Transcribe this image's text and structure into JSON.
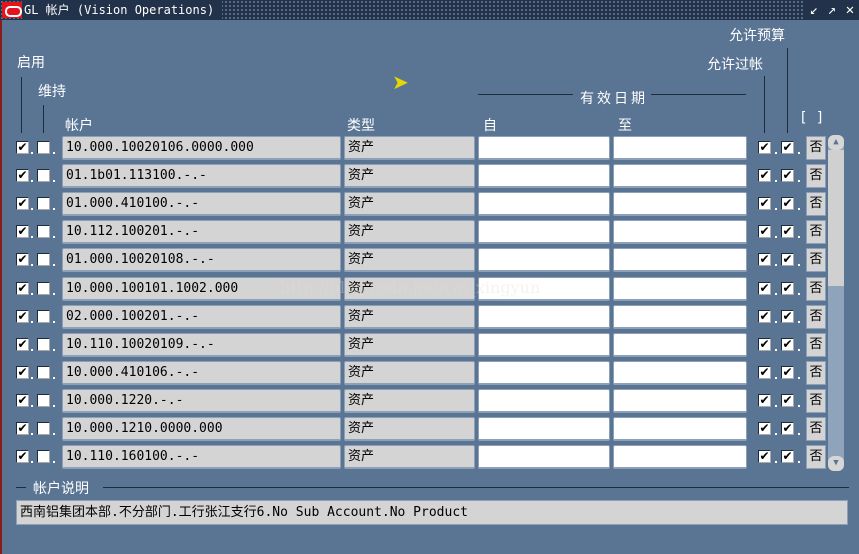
{
  "window": {
    "title": "GL 帐户 (Vision Operations)",
    "buttons": [
      "minimize",
      "restore",
      "close"
    ]
  },
  "headers": {
    "enabled": "启用",
    "maintain": "维持",
    "account": "帐户",
    "type": "类型",
    "effective_dates": "有效日期",
    "from": "自",
    "to": "至",
    "allow_posting": "允许过帐",
    "allow_budget": "允许预算",
    "brackets": "[ ]"
  },
  "rows": [
    {
      "account": "10.000.10020106.0000.000",
      "type": "资产",
      "enabled": true,
      "maintain": false,
      "from": "",
      "to": "",
      "posting": true,
      "budget": true,
      "flag": "否"
    },
    {
      "account": "01.1b01.113100.-.-",
      "type": "资产",
      "enabled": true,
      "maintain": false,
      "from": "",
      "to": "",
      "posting": true,
      "budget": true,
      "flag": "否"
    },
    {
      "account": "01.000.410100.-.-",
      "type": "资产",
      "enabled": true,
      "maintain": false,
      "from": "",
      "to": "",
      "posting": true,
      "budget": true,
      "flag": "否"
    },
    {
      "account": "10.112.100201.-.-",
      "type": "资产",
      "enabled": true,
      "maintain": false,
      "from": "",
      "to": "",
      "posting": true,
      "budget": true,
      "flag": "否"
    },
    {
      "account": "01.000.10020108.-.-",
      "type": "资产",
      "enabled": true,
      "maintain": false,
      "from": "",
      "to": "",
      "posting": true,
      "budget": true,
      "flag": "否"
    },
    {
      "account": "10.000.100101.1002.000",
      "type": "资产",
      "enabled": true,
      "maintain": false,
      "from": "",
      "to": "",
      "posting": true,
      "budget": true,
      "flag": "否"
    },
    {
      "account": "02.000.100201.-.-",
      "type": "资产",
      "enabled": true,
      "maintain": false,
      "from": "",
      "to": "",
      "posting": true,
      "budget": true,
      "flag": "否"
    },
    {
      "account": "10.110.10020109.-.-",
      "type": "资产",
      "enabled": true,
      "maintain": false,
      "from": "",
      "to": "",
      "posting": true,
      "budget": true,
      "flag": "否"
    },
    {
      "account": "10.000.410106.-.-",
      "type": "资产",
      "enabled": true,
      "maintain": false,
      "from": "",
      "to": "",
      "posting": true,
      "budget": true,
      "flag": "否"
    },
    {
      "account": "10.000.1220.-.-",
      "type": "资产",
      "enabled": true,
      "maintain": false,
      "from": "",
      "to": "",
      "posting": true,
      "budget": true,
      "flag": "否"
    },
    {
      "account": "10.000.1210.0000.000",
      "type": "资产",
      "enabled": true,
      "maintain": false,
      "from": "",
      "to": "",
      "posting": true,
      "budget": true,
      "flag": "否"
    },
    {
      "account": "10.110.160100.-.-",
      "type": "资产",
      "enabled": true,
      "maintain": false,
      "from": "",
      "to": "",
      "posting": true,
      "budget": true,
      "flag": "否"
    }
  ],
  "description": {
    "label": "帐户说明",
    "value": "西南铝集团本部.不分部门.工行张江支行6.No Sub Account.No Product"
  },
  "watermark": "http://blog.csdn.net/cai_xingyun"
}
